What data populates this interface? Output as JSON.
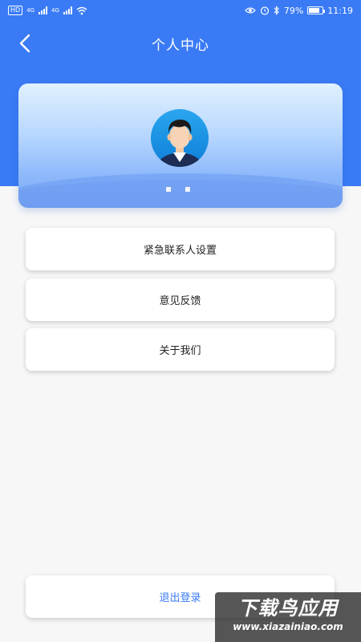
{
  "status_bar": {
    "hd": "HD",
    "network1": "4G",
    "network2": "4G",
    "battery": "79%",
    "battery_level": 0.79,
    "time": "11:19"
  },
  "header": {
    "title": "个人中心"
  },
  "profile": {
    "username": "▪ ▪"
  },
  "menu": {
    "items": [
      {
        "label": "紧急联系人设置"
      },
      {
        "label": "意见反馈"
      },
      {
        "label": "关于我们"
      }
    ],
    "logout_label": "退出登录"
  },
  "watermark": {
    "main": "下载鸟应用",
    "sub": "www.xiazainiao.com"
  },
  "colors": {
    "primary": "#3a7bf5",
    "background": "#f7f7f8"
  }
}
